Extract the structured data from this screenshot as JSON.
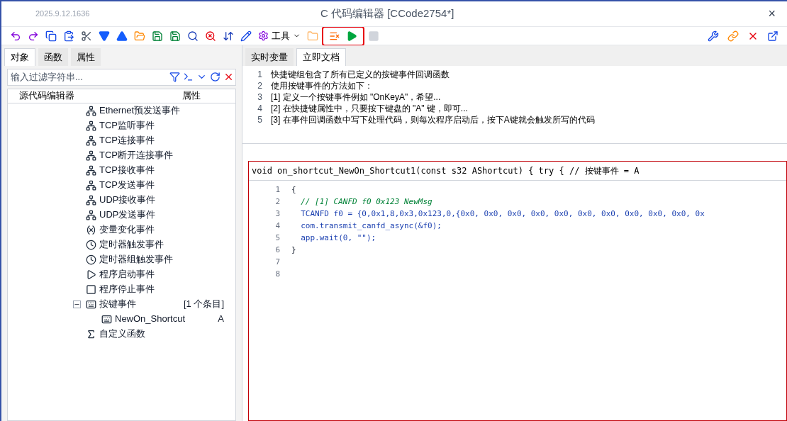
{
  "window": {
    "version": "2025.9.12.1636",
    "title": "C 代码编辑器 [CCode2754*]",
    "close": "×"
  },
  "toolbar": {
    "tools_menu": "工具"
  },
  "left_panel": {
    "tabs": [
      {
        "label": "对象",
        "selected": true
      },
      {
        "label": "函数",
        "selected": false
      },
      {
        "label": "属性",
        "selected": false
      }
    ],
    "filter": {
      "placeholder": "输入过滤字符串..."
    },
    "columns": [
      "源代码编辑器",
      "属性"
    ],
    "tree": [
      {
        "label": "Ethernet预发送事件",
        "kind": "net"
      },
      {
        "label": "TCP监听事件",
        "kind": "net"
      },
      {
        "label": "TCP连接事件",
        "kind": "net"
      },
      {
        "label": "TCP断开连接事件",
        "kind": "net"
      },
      {
        "label": "TCP接收事件",
        "kind": "net"
      },
      {
        "label": "TCP发送事件",
        "kind": "net"
      },
      {
        "label": "UDP接收事件",
        "kind": "net"
      },
      {
        "label": "UDP发送事件",
        "kind": "net"
      },
      {
        "label": "变量变化事件",
        "kind": "variable"
      },
      {
        "label": "定时器触发事件",
        "kind": "timer"
      },
      {
        "label": "定时器组触发事件",
        "kind": "timer"
      },
      {
        "label": "程序启动事件",
        "kind": "start"
      },
      {
        "label": "程序停止事件",
        "kind": "stop"
      },
      {
        "label": "按键事件",
        "kind": "keyboard",
        "expanded": true,
        "value": "[1 个条目]",
        "children": [
          {
            "label": "NewOn_Shortcut",
            "kind": "keyboard",
            "value": "A"
          }
        ]
      },
      {
        "label": "自定义函数",
        "kind": "function"
      }
    ]
  },
  "right_panel": {
    "tabs": [
      {
        "label": "实时变量",
        "selected": false
      },
      {
        "label": "立即文档",
        "selected": true
      }
    ],
    "doc_lines": [
      {
        "number": "1",
        "text": "快捷键组包含了所有已定义的按键事件回调函数"
      },
      {
        "number": "2",
        "text": "使用按键事件的方法如下："
      },
      {
        "number": "3",
        "text": "[1] 定义一个按键事件例如 \"OnKeyA\"，希望..."
      },
      {
        "number": "4",
        "text": "[2] 在快捷键属性中，只要按下键盘的 \"A\" 键，即可..."
      },
      {
        "number": "5",
        "text": "[3] 在事件回调函数中写下处理代码，则每次程序启动后，按下A键就会触发所写的代码"
      }
    ],
    "code_header": "void on_shortcut_NewOn_Shortcut1(const s32 AShortcut) { try { // 按键事件 = A",
    "code_lines": [
      {
        "number": "1",
        "kind": "plain",
        "text": "{"
      },
      {
        "number": "2",
        "kind": "comment",
        "text": "  // [1] CANFD f0 0x123 NewMsg"
      },
      {
        "number": "3",
        "kind": "code",
        "text": "  TCANFD f0 = {0,0x1,8,0x3,0x123,0,{0x0, 0x0, 0x0, 0x0, 0x0, 0x0, 0x0, 0x0, 0x0, 0x0, 0x"
      },
      {
        "number": "4",
        "kind": "code",
        "text": "  com.transmit_canfd_async(&f0);"
      },
      {
        "number": "5",
        "kind": "code",
        "text": "  app.wait(0, \"\");"
      },
      {
        "number": "6",
        "kind": "plain",
        "text": "}"
      },
      {
        "number": "7"
      },
      {
        "number": "8"
      }
    ]
  }
}
